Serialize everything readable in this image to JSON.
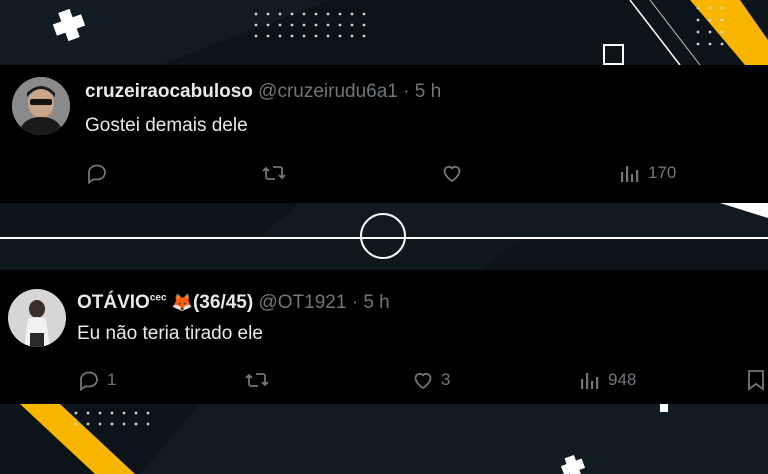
{
  "colors": {
    "accent": "#f7b500",
    "background": "#0c1419",
    "post_bg": "#000000",
    "text": "#e7e9ea",
    "muted": "#71767b"
  },
  "post1": {
    "display_name": "cruzeiraocabuloso",
    "handle": "@cruzeirudu6a1",
    "separator": "·",
    "time": "5 h",
    "text": "Gostei demais dele",
    "views": "170",
    "icons": [
      "reply-icon",
      "retweet-icon",
      "like-icon",
      "views-icon"
    ]
  },
  "post2": {
    "display_name": "OTÁVIO",
    "name_suffix": "cec",
    "name_emoji": "🦊",
    "name_tag": "(36/45)",
    "handle": "@OT1921",
    "separator": "·",
    "time": "5 h",
    "text": "Eu não teria tirado ele",
    "replies": "1",
    "likes": "3",
    "views": "948",
    "icons": [
      "reply-icon",
      "retweet-icon",
      "like-icon",
      "views-icon",
      "bookmark-icon"
    ]
  }
}
